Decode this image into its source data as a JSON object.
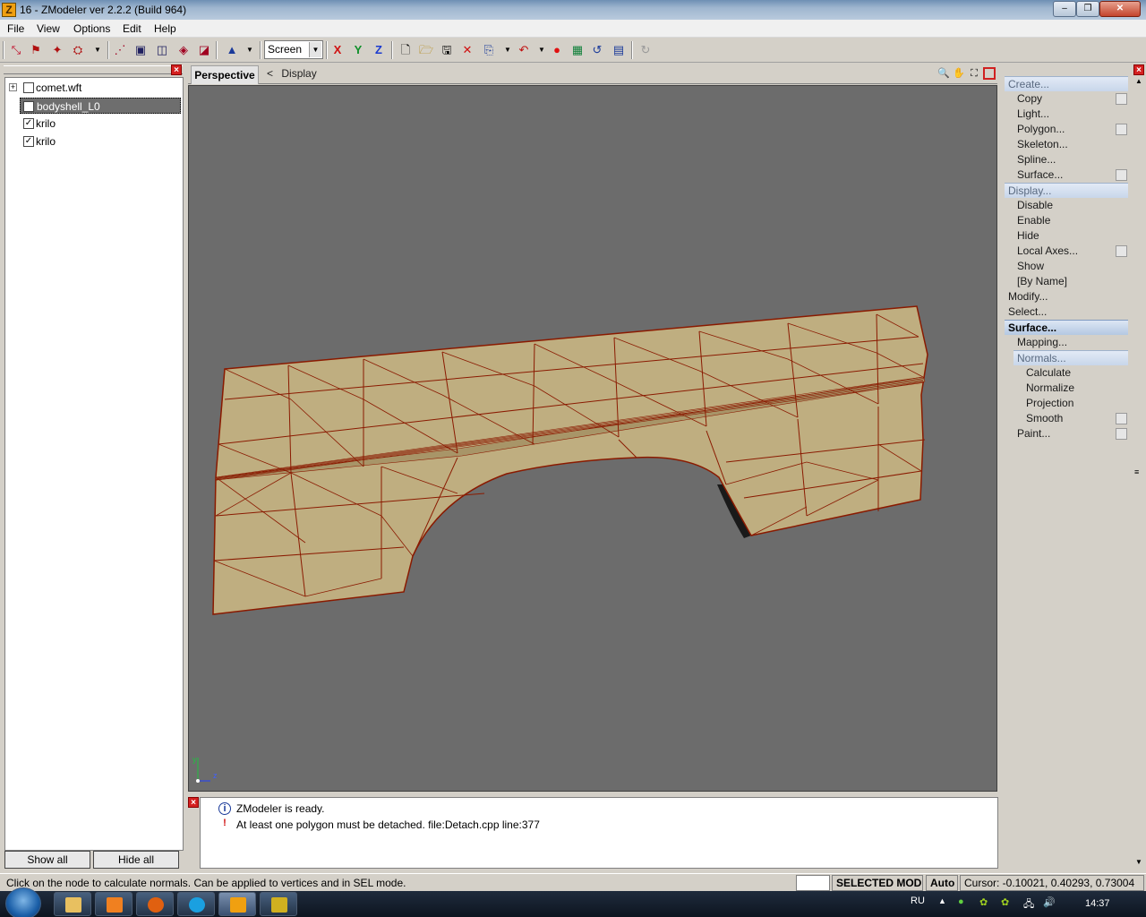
{
  "window": {
    "title": "16 - ZModeler ver 2.2.2 (Build 964)",
    "app_icon": "Z"
  },
  "menu": [
    "File",
    "View",
    "Options",
    "Edit",
    "Help"
  ],
  "toolbar": {
    "view_select": "Screen",
    "axis_x": "X",
    "axis_y": "Y",
    "axis_z": "Z"
  },
  "tree": {
    "nodes": [
      {
        "label": "comet.wft",
        "checked": false,
        "expander": "+"
      },
      {
        "label": "bodyshell_L0",
        "checked": false,
        "selected": true
      },
      {
        "label": "krilo",
        "checked": true
      },
      {
        "label": "krilo",
        "checked": true
      }
    ],
    "show_all": "Show all",
    "hide_all": "Hide all"
  },
  "viewport": {
    "tab": "Perspective",
    "breadcrumb_sep": "<",
    "breadcrumb": "Display",
    "axis_y_label": "y",
    "axis_z_label": "z",
    "background": "#6c6c6c",
    "mesh_fill": "#bfae80",
    "mesh_edge": "#8a1a00"
  },
  "log": {
    "lines": [
      {
        "icon": "info-icon",
        "text": "ZModeler is ready."
      },
      {
        "icon": "exclamation-icon",
        "text": "At least one polygon must be detached. file:Detach.cpp line:377"
      }
    ]
  },
  "commands": [
    {
      "label": "Create...",
      "style": "hl",
      "indent": 0,
      "option": false
    },
    {
      "label": "Copy",
      "indent": 1,
      "option": true
    },
    {
      "label": "Light...",
      "indent": 1,
      "option": false
    },
    {
      "label": "Polygon...",
      "indent": 1,
      "option": true
    },
    {
      "label": "Skeleton...",
      "indent": 1,
      "option": false
    },
    {
      "label": "Spline...",
      "indent": 1,
      "option": false
    },
    {
      "label": "Surface...",
      "indent": 1,
      "option": true
    },
    {
      "label": "Display...",
      "style": "hl",
      "indent": 0,
      "option": false
    },
    {
      "label": "Disable",
      "indent": 1,
      "option": false
    },
    {
      "label": "Enable",
      "indent": 1,
      "option": false
    },
    {
      "label": "Hide",
      "indent": 1,
      "option": false
    },
    {
      "label": "Local Axes...",
      "indent": 1,
      "option": true
    },
    {
      "label": "Show",
      "indent": 1,
      "option": false
    },
    {
      "label": "[By Name]",
      "indent": 1,
      "option": false
    },
    {
      "label": "Modify...",
      "indent": 0,
      "option": false
    },
    {
      "label": "Select...",
      "indent": 0,
      "option": false
    },
    {
      "label": "Surface...",
      "style": "active",
      "indent": 0,
      "option": false
    },
    {
      "label": "Mapping...",
      "indent": 1,
      "option": false
    },
    {
      "label": "Normals...",
      "style": "hl",
      "indent": 1,
      "option": false
    },
    {
      "label": "Calculate",
      "indent": 2,
      "option": false
    },
    {
      "label": "Normalize",
      "indent": 2,
      "option": false
    },
    {
      "label": "Projection",
      "indent": 2,
      "option": false
    },
    {
      "label": "Smooth",
      "indent": 2,
      "option": true
    },
    {
      "label": "Paint...",
      "indent": 1,
      "option": true
    }
  ],
  "status": {
    "hint": "Click on the node to calculate normals. Can be applied to vertices and in SEL mode.",
    "mode": "SELECTED MODE",
    "auto": "Auto",
    "cursor": "Cursor: -0.10021, 0.40293, 0.73004"
  },
  "taskbar": {
    "lang": "RU",
    "time": "14:37"
  }
}
